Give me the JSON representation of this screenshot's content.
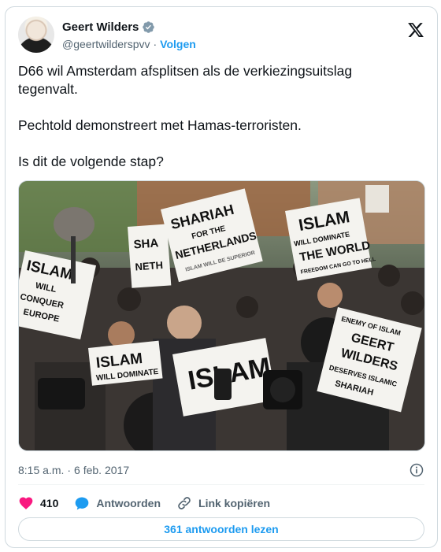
{
  "author": {
    "name": "Geert Wilders",
    "handle": "@geertwilderspvv",
    "separator": "·",
    "follow_label": "Volgen"
  },
  "tweet": {
    "text": "D66 wil Amsterdam afsplitsen als de verkiezingsuitslag\ntegenvalt.\n\nPechtold demonstreert met Hamas-terroristen.\n\nIs dit de volgende stap?"
  },
  "photo": {
    "signs": [
      "ISLAM WILL CONQUER EUROPE",
      "SHA NETH",
      "SHARIAH FOR THE NETHERLANDS",
      "ISLAM WILL BE SUPERIOR",
      "ISLAM WILL DOMINATE THE WORLD",
      "FREEDOM CAN GO TO HELL",
      "ISLAM WILL DOMINATE",
      "ENEMY OF ISLAM GEERT WILDERS DESERVES ISLAMIC SHARIAH",
      "ISLAM"
    ]
  },
  "meta": {
    "time": "8:15 a.m.",
    "separator": "·",
    "date": "6 feb. 2017"
  },
  "actions": {
    "likes": "410",
    "reply_label": "Antwoorden",
    "copy_link_label": "Link kopiëren"
  },
  "read_replies_label": "361 antwoorden lezen",
  "colors": {
    "accent": "#1d9bf0",
    "like": "#f91880",
    "muted": "#536471",
    "border": "#cfd9de"
  },
  "icons": [
    "verified-badge-icon",
    "x-logo-icon",
    "info-icon",
    "heart-icon",
    "reply-bubble-icon",
    "link-icon"
  ]
}
